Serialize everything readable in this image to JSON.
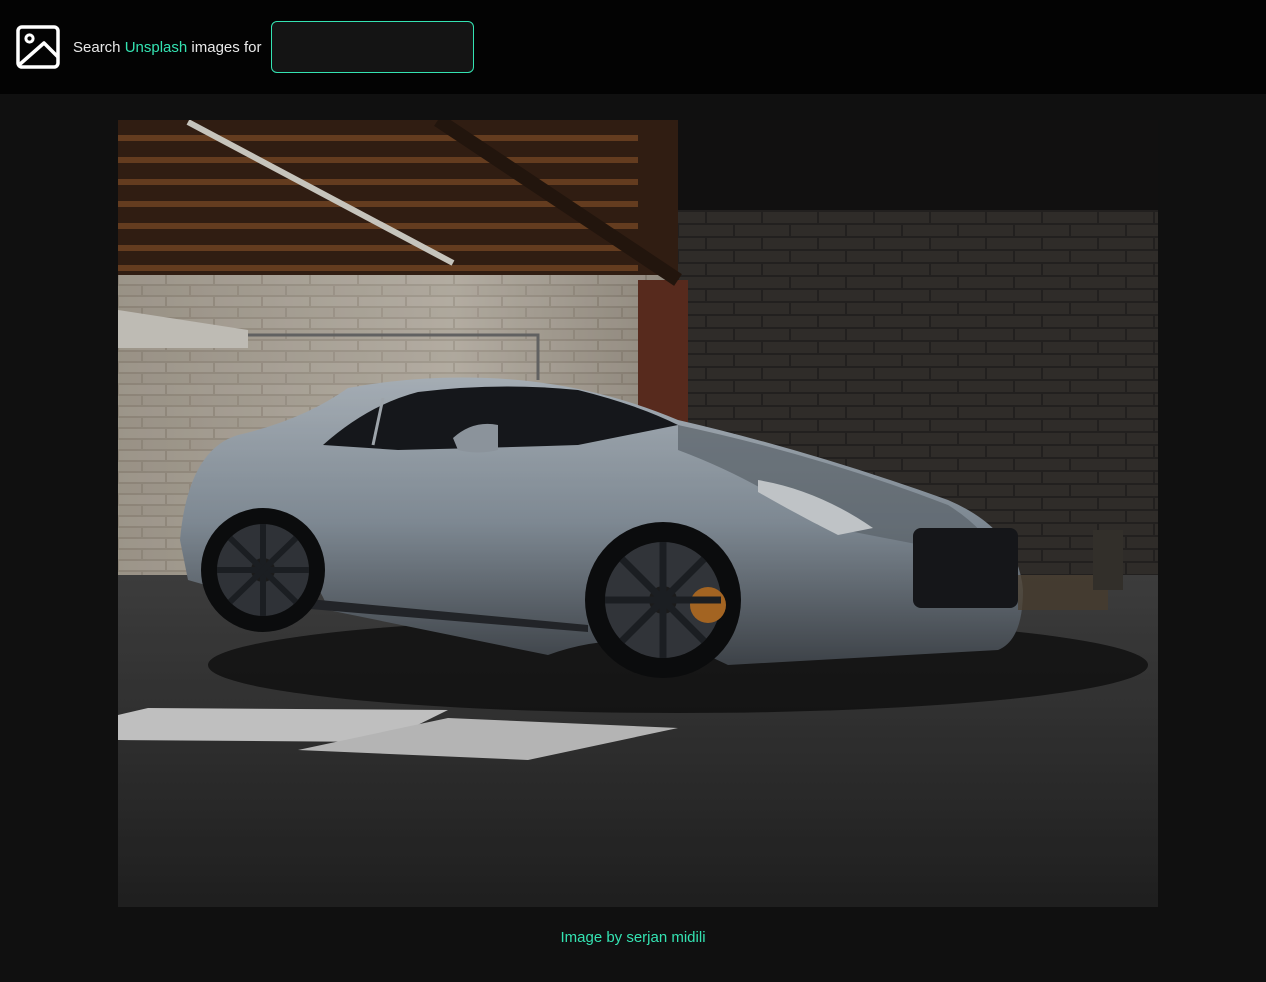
{
  "header": {
    "logo_icon": "image-icon",
    "search_prefix": "Search",
    "brand_name": "Unsplash",
    "search_suffix": "images for",
    "search_value": "",
    "accent_color": "#34e3b2"
  },
  "main": {
    "image_subject": "silver sports car parked in a dim brick garage",
    "credit_text": "Image by serjan midili"
  }
}
